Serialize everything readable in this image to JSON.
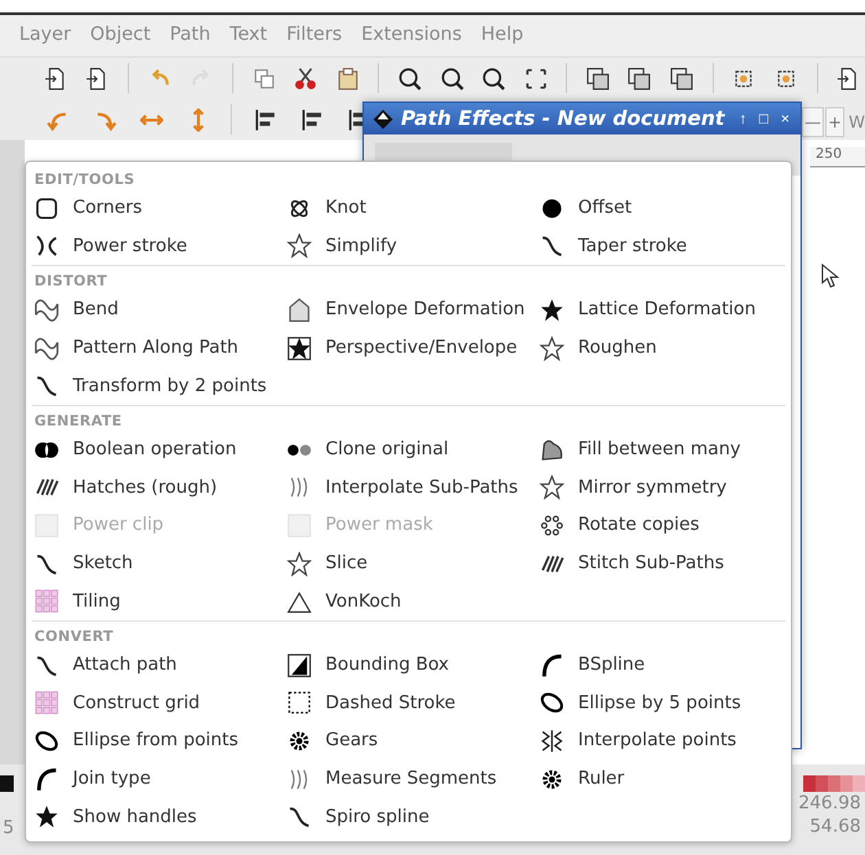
{
  "menu_bar": [
    "Layer",
    "Object",
    "Path",
    "Text",
    "Filters",
    "Extensions",
    "Help"
  ],
  "dialog": {
    "title": "Path Effects - New document",
    "title_buttons": [
      "↑",
      "□",
      "×"
    ]
  },
  "spin_button": {
    "minus": "—",
    "plus": "+",
    "label": "W"
  },
  "ruler": {
    "label": "250"
  },
  "popover": {
    "sections": [
      {
        "title": "EDIT/TOOLS",
        "items": [
          {
            "label": "Corners",
            "disabled": false
          },
          {
            "label": "Knot",
            "disabled": false
          },
          {
            "label": "Offset",
            "disabled": false
          },
          {
            "label": "Power stroke",
            "disabled": false
          },
          {
            "label": "Simplify",
            "disabled": false
          },
          {
            "label": "Taper stroke",
            "disabled": false
          }
        ]
      },
      {
        "title": "DISTORT",
        "items": [
          {
            "label": "Bend",
            "disabled": false
          },
          {
            "label": "Envelope Deformation",
            "disabled": false
          },
          {
            "label": "Lattice Deformation",
            "disabled": false
          },
          {
            "label": "Pattern Along Path",
            "disabled": false
          },
          {
            "label": "Perspective/Envelope",
            "disabled": false
          },
          {
            "label": "Roughen",
            "disabled": false
          },
          {
            "label": "Transform by 2 points",
            "disabled": false
          }
        ]
      },
      {
        "title": "GENERATE",
        "items": [
          {
            "label": "Boolean operation",
            "disabled": false
          },
          {
            "label": "Clone original",
            "disabled": false
          },
          {
            "label": "Fill between many",
            "disabled": false
          },
          {
            "label": "Hatches (rough)",
            "disabled": false
          },
          {
            "label": "Interpolate Sub-Paths",
            "disabled": false
          },
          {
            "label": "Mirror symmetry",
            "disabled": false
          },
          {
            "label": "Power clip",
            "disabled": true
          },
          {
            "label": "Power mask",
            "disabled": true
          },
          {
            "label": "Rotate copies",
            "disabled": false
          },
          {
            "label": "Sketch",
            "disabled": false
          },
          {
            "label": "Slice",
            "disabled": false
          },
          {
            "label": "Stitch Sub-Paths",
            "disabled": false
          },
          {
            "label": "Tiling",
            "disabled": false
          },
          {
            "label": "VonKoch",
            "disabled": false
          }
        ]
      },
      {
        "title": "CONVERT",
        "items": [
          {
            "label": "Attach path",
            "disabled": false
          },
          {
            "label": "Bounding Box",
            "disabled": false
          },
          {
            "label": "BSpline",
            "disabled": false
          },
          {
            "label": "Construct grid",
            "disabled": false
          },
          {
            "label": "Dashed Stroke",
            "disabled": false
          },
          {
            "label": "Ellipse by 5 points",
            "disabled": false
          },
          {
            "label": "Ellipse from points",
            "disabled": false
          },
          {
            "label": "Gears",
            "disabled": false
          },
          {
            "label": "Interpolate points",
            "disabled": false
          },
          {
            "label": "Join type",
            "disabled": false
          },
          {
            "label": "Measure Segments",
            "disabled": false
          },
          {
            "label": "Ruler",
            "disabled": false
          },
          {
            "label": "Show handles",
            "disabled": false
          },
          {
            "label": "Spiro spline",
            "disabled": false
          }
        ]
      }
    ]
  },
  "status": {
    "fragment": "5",
    "readings": [
      "246.98",
      "54.68"
    ]
  }
}
